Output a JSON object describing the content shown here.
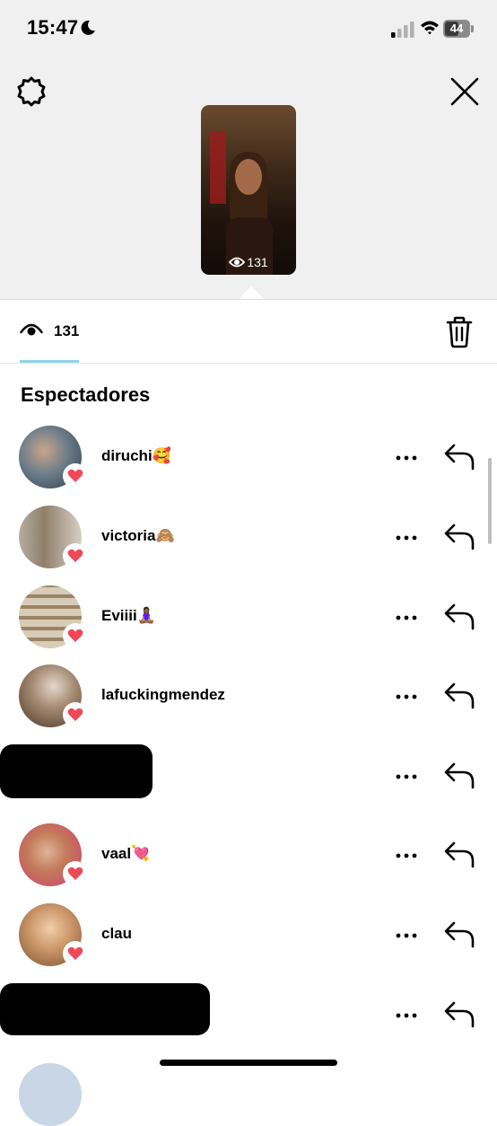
{
  "status": {
    "time": "15:47",
    "battery": "44"
  },
  "icons": {
    "settings": "gear-icon",
    "close": "close-icon",
    "views": "eye-icon",
    "delete": "trash-icon",
    "more": "more-icon",
    "reply": "reply-icon",
    "liked": "heart-icon"
  },
  "story": {
    "view_count": "131"
  },
  "stats": {
    "view_count": "131"
  },
  "section": {
    "title": "Espectadores"
  },
  "viewers": [
    {
      "username": "diruchi🥰",
      "liked": true
    },
    {
      "username": "victoria🙈",
      "liked": true
    },
    {
      "username": "Eviiii🧘🏾‍♀️",
      "liked": true
    },
    {
      "username": "lafuckingmendez",
      "liked": true
    },
    {
      "username": "",
      "liked": false,
      "redacted": true
    },
    {
      "username": "vaal💘",
      "liked": true
    },
    {
      "username": "clau",
      "liked": true
    },
    {
      "username": "",
      "liked": false,
      "redacted": true
    }
  ],
  "colors": {
    "heart": "#ed4956",
    "top_background": "#f0f0f0",
    "tab_underline": "#8fd3ea"
  }
}
